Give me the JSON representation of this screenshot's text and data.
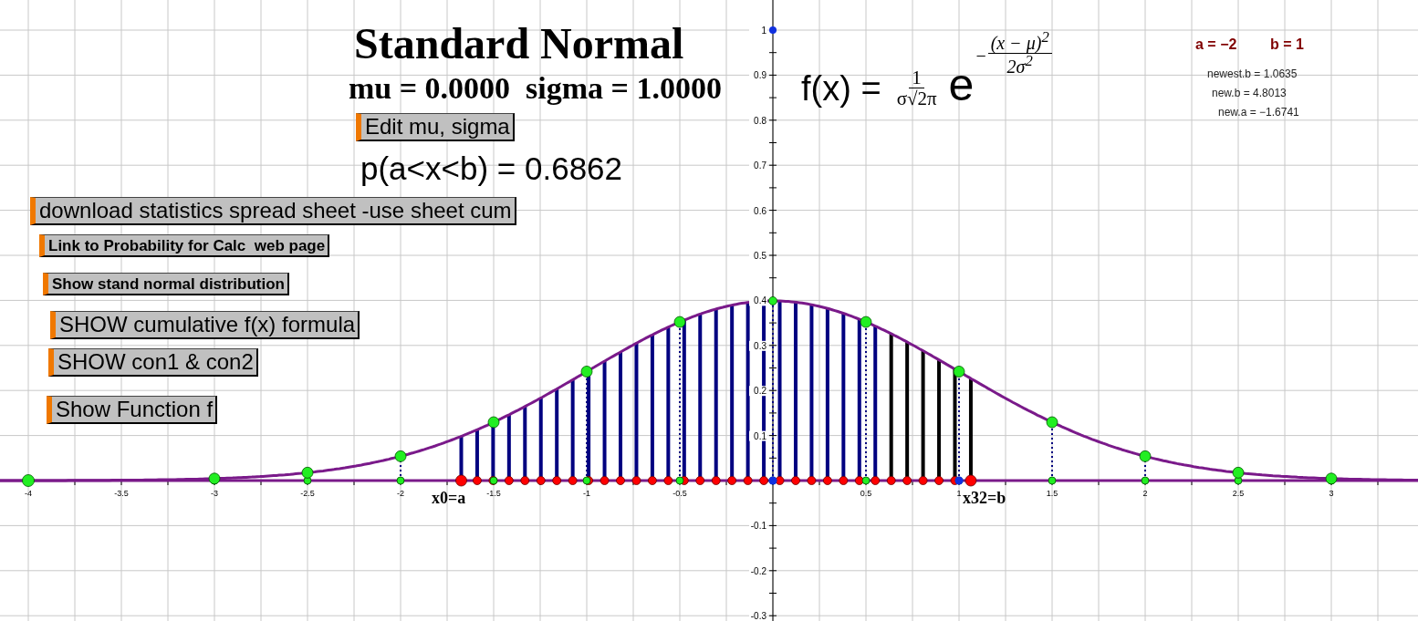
{
  "title": "Standard Normal",
  "parameters": "mu = 0.0000  sigma = 1.0000",
  "edit_button": {
    "label": "Edit mu, sigma",
    "kind": "large"
  },
  "probability": "p(a<x<b) = 0.6862",
  "buttons": [
    {
      "label": "download statistics spread sheet -use sheet cum",
      "kind": "large"
    },
    {
      "label": "Link to Probability for Calc  web page",
      "kind": "small"
    },
    {
      "label": "Show stand normal distribution",
      "kind": "small"
    },
    {
      "label": "SHOW cumulative f(x) formula",
      "kind": "large"
    },
    {
      "label": "SHOW con1 & con2",
      "kind": "large"
    },
    {
      "label": "Show Function f",
      "kind": "large"
    }
  ],
  "formula": {
    "lhs": "f(x) =",
    "numerator": "1",
    "denominator": "σ√2π",
    "base": "e",
    "exponent_sign": "−",
    "exponent_numerator": "(x − μ)$^{2}$",
    "exponent_denominator": "2σ$^{2}$"
  },
  "bounds": [
    "a = −2",
    "b = 1"
  ],
  "values": [
    "newest.b = 1.0635",
    "new.b = 4.8013",
    "new.a = −1.6741"
  ],
  "graph": {
    "x_ticks": [
      "-4",
      "-3.5",
      "-3",
      "-2.5",
      "-2",
      "-1.5",
      "-1",
      "-0.5",
      "0.5",
      "1",
      "1.5",
      "2",
      "2.5",
      "3"
    ],
    "y_ticks": [
      "1",
      "0.9",
      "0.8",
      "0.7",
      "0.6",
      "0.5",
      "0.4",
      "0.3",
      "0.2",
      "0.1",
      "-0.1",
      "-0.2",
      "-0.3"
    ],
    "point_labels": [
      "x0=a",
      "x32=b"
    ]
  }
}
